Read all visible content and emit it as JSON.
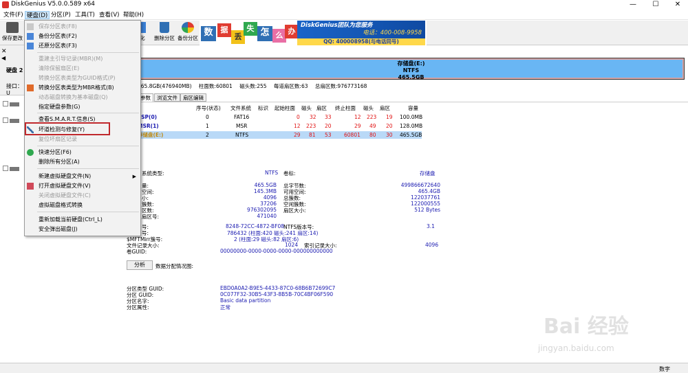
{
  "window": {
    "title": "DiskGenius V5.0.0.589 x64",
    "min": "—",
    "max": "☐",
    "close": "✕"
  },
  "menubar": [
    "文件(F)",
    "硬盘(D)",
    "分区(P)",
    "工具(T)",
    "查看(V)",
    "帮助(H)"
  ],
  "toolbar": {
    "save_label": "保存更改",
    "btn2": "化",
    "delete_label": "删除分区",
    "backup_label": "备份分区"
  },
  "banner": {
    "tiles": [
      "数",
      "据",
      "丢",
      "失",
      "怎",
      "么",
      "办"
    ],
    "brand": "DiskGenius团队为您服务",
    "phone": "电话：400-008-9958",
    "qq": "QQ: 400008958(与电话同号)"
  },
  "leftpanel": {
    "disk_label": "硬盘 2",
    "port_label": "接口：U"
  },
  "disk_bar": {
    "name": "存储盘(E:)",
    "fs": "NTFS",
    "size": "465.5GB"
  },
  "disk_info": {
    "capacity": "465.8GB(476940MB)",
    "cylinders": "柱面数:60801",
    "heads": "磁头数:255",
    "sectors": "每道扇区数:63",
    "total": "总扇区数:976773168"
  },
  "tabs": [
    "参数",
    "浏览文件",
    "扇区编辑"
  ],
  "table": {
    "headers": [
      "序号(状态)",
      "文件系统",
      "标识",
      "起始柱面",
      "磁头",
      "扇区",
      "终止柱面",
      "磁头",
      "扇区",
      "容量"
    ],
    "rows": [
      {
        "name": "ESP(0)",
        "idx": "0",
        "fs": "FAT16",
        "id": "",
        "sc": "0",
        "sh": "32",
        "ss": "33",
        "ec": "12",
        "eh": "223",
        "es": "19",
        "cap": "100.0MB"
      },
      {
        "name": "MSR(1)",
        "idx": "1",
        "fs": "MSR",
        "id": "",
        "sc": "12",
        "sh": "223",
        "ss": "20",
        "ec": "29",
        "eh": "49",
        "es": "20",
        "cap": "128.0MB"
      },
      {
        "name": "存储盘(E:)",
        "idx": "2",
        "fs": "NTFS",
        "id": "",
        "sc": "29",
        "sh": "81",
        "ss": "53",
        "ec": "60801",
        "eh": "80",
        "es": "30",
        "cap": "465.5GB"
      }
    ]
  },
  "details": {
    "fs_type_label": "系统类型:",
    "fs_type_value": "NTFS",
    "volume_label": "卷标:",
    "volume_value": "存储盘",
    "left": [
      {
        "label": "量:",
        "value": "465.5GB"
      },
      {
        "label": "空间:",
        "value": "145.3MB"
      },
      {
        "label": "小:",
        "value": "4096"
      },
      {
        "label": "簇数:",
        "value": "37206"
      },
      {
        "label": "区数:",
        "value": "976302095"
      },
      {
        "label": "扇区号:",
        "value": "471040"
      }
    ],
    "right": [
      {
        "label": "总字节数:",
        "value": "499866672640"
      },
      {
        "label": "可用空间:",
        "value": "465.4GB"
      },
      {
        "label": "总簇数:",
        "value": "122037761"
      },
      {
        "label": "空闲簇数:",
        "value": "122000555"
      },
      {
        "label": "扇区大小:",
        "value": "512 Bytes"
      }
    ],
    "serial_label": "号:",
    "serial_value": "8248-72CC-4872-BF08",
    "ntfs_ver_label": "NTFS版本号:",
    "ntfs_ver_value": "3.1",
    "mft_label": "号:",
    "mft_value": "786432 (柱面:420 磁头:241 扇区:14)",
    "mftmirr_label": "$MFTMirr簇号:",
    "mftmirr_value": "2 (柱面:29 磁头:82 扇区:6)",
    "filerec_label": "文件记录大小:",
    "filerec_value": "1024",
    "idxrec_label": "索引记录大小:",
    "idxrec_value": "4096",
    "guid_label": "卷GUID:",
    "guid_value": "00000000-0000-0000-0000-000000000000",
    "analyze_btn": "分析",
    "alloc_label": "数据分配情况图:",
    "ptype_guid_label": "分区类型 GUID:",
    "ptype_guid_value": "EBD0A0A2-B9E5-4433-87C0-68B6B72699C7",
    "p_guid_label": "分区 GUID:",
    "p_guid_value": "0C077F32-30B5-43F3-8B5B-70C4BF06F590",
    "pname_label": "分区名字:",
    "pname_value": "Basic data partition",
    "pattr_label": "分区属性:",
    "pattr_value": "正常"
  },
  "dropdown": [
    {
      "label": "保存分区表(F8)",
      "disabled": true
    },
    {
      "label": "备份分区表(F2)",
      "disabled": false
    },
    {
      "label": "还原分区表(F3)",
      "disabled": false
    },
    {
      "label": "重建主引导记录(MBR)(M)",
      "disabled": true
    },
    {
      "label": "清除保留扇区(E)",
      "disabled": true
    },
    {
      "label": "转换分区表类型为GUID格式(P)",
      "disabled": true
    },
    {
      "label": "转换分区表类型为MBR格式(B)",
      "disabled": false
    },
    {
      "label": "动态磁盘转换为基本磁盘(Q)",
      "disabled": true
    },
    {
      "label": "指定硬盘参数(G)",
      "disabled": false
    },
    {
      "label": "查看S.M.A.R.T.信息(S)",
      "disabled": false
    },
    {
      "label": "坏道检测与修复(Y)",
      "disabled": false
    },
    {
      "label": "复位坏扇区记录",
      "disabled": true
    },
    {
      "label": "快速分区(F6)",
      "disabled": false
    },
    {
      "label": "删除所有分区(A)",
      "disabled": false
    },
    {
      "label": "新建虚拟硬盘文件(N)",
      "disabled": false
    },
    {
      "label": "打开虚拟硬盘文件(V)",
      "disabled": false
    },
    {
      "label": "关闭虚拟硬盘文件(C)",
      "disabled": true
    },
    {
      "label": "虚拟磁盘格式转换",
      "disabled": false
    },
    {
      "label": "重新加载当前硬盘(Ctrl_L)",
      "disabled": false
    },
    {
      "label": "安全弹出磁盘(J)",
      "disabled": false
    }
  ],
  "statusbar": {
    "mode": "数字"
  },
  "watermark": {
    "main": "Bai 经验",
    "url": "jingyan.baidu.com"
  },
  "colors": {
    "accent_blue": "#69b6f4",
    "selected_row": "#b9d9f7",
    "highlight_red": "#c0282c",
    "value_blue": "#1a1ab0"
  }
}
